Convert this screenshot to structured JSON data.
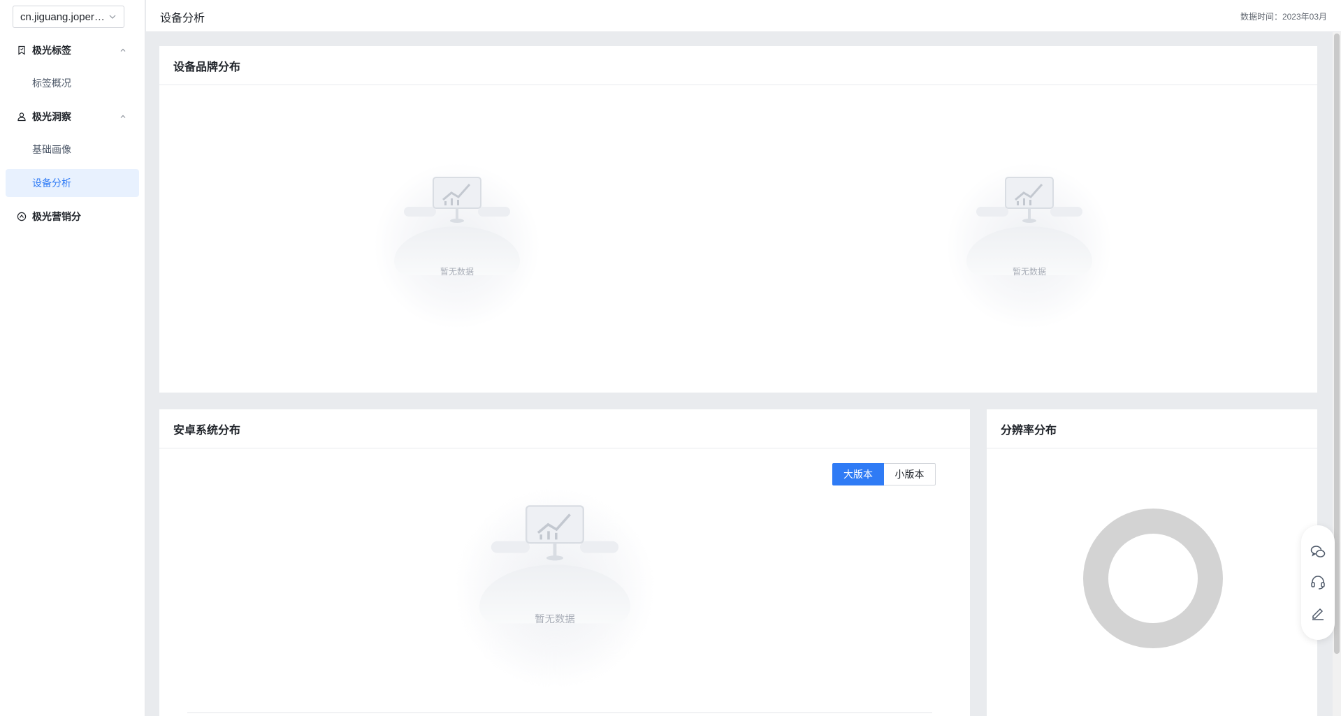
{
  "sidebar": {
    "app_select": "cn.jiguang.joper…",
    "groups": [
      {
        "label": "极光标签",
        "icon": "bookmark-icon"
      },
      {
        "label": "极光洞察",
        "icon": "user-icon"
      },
      {
        "label": "极光营销分",
        "icon": "compass-icon"
      }
    ],
    "items": [
      {
        "label": "标签概况"
      },
      {
        "label": "基础画像"
      },
      {
        "label": "设备分析",
        "active": true
      }
    ]
  },
  "header": {
    "title": "设备分析",
    "data_time": "数据时间：2023年03月"
  },
  "cards": {
    "brand": {
      "title": "设备品牌分布",
      "empty_left": "暂无数据",
      "empty_right": "暂无数据"
    },
    "android": {
      "title": "安卓系统分布",
      "toggle_major": "大版本",
      "toggle_minor": "小版本",
      "empty": "暂无数据"
    },
    "resolution": {
      "title": "分辨率分布"
    }
  },
  "floatbar": {
    "icons": [
      "wechat-icon",
      "headset-icon",
      "edit-icon"
    ]
  },
  "colors": {
    "accent": "#2f7bf5",
    "active_bg": "#e8f1fe"
  }
}
